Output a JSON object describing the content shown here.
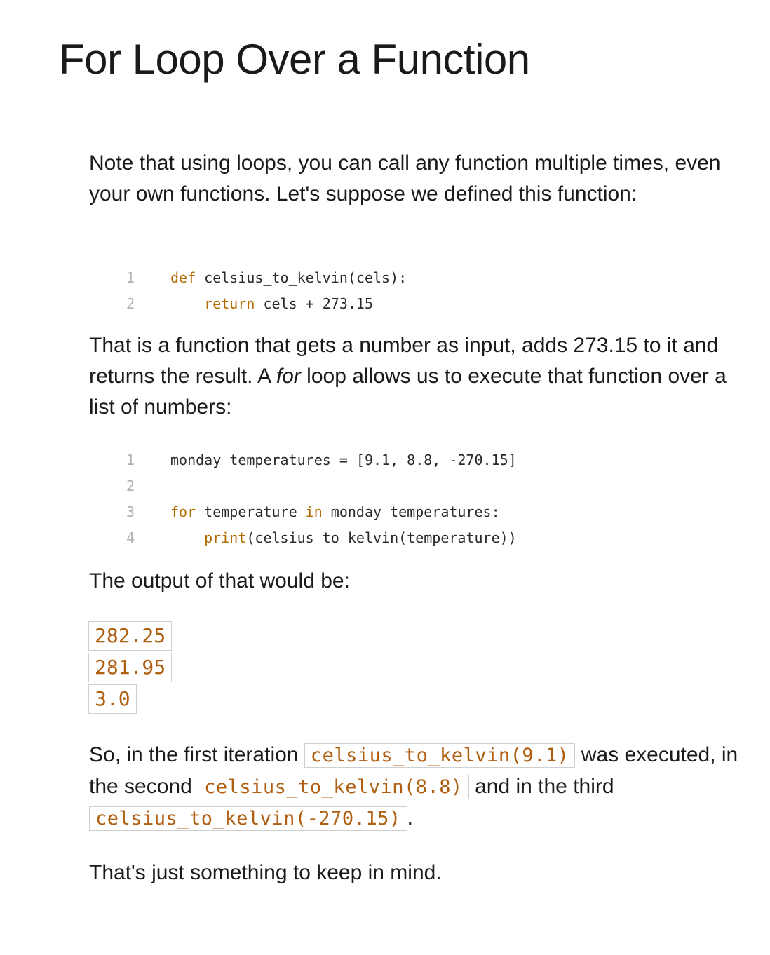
{
  "title": "For Loop Over a Function",
  "intro": "Note that using loops, you can call any function multiple times, even your own functions. Let's suppose we defined this function:",
  "code1": {
    "line_numbers": [
      "1",
      "2"
    ],
    "l1_kw": "def",
    "l1_rest": " celsius_to_kelvin(cels):",
    "l2_indent": "    ",
    "l2_kw": "return",
    "l2_rest": " cels + 273.15"
  },
  "explain": {
    "before": "That is a function that gets a number as input, adds 273.15 to it and returns the result. A ",
    "em": "for",
    "after": " loop allows us to execute that function over a list of numbers:"
  },
  "code2": {
    "line_numbers": [
      "1",
      "2",
      "3",
      "4"
    ],
    "l1": "monday_temperatures = [9.1, 8.8, -270.15]",
    "l3_kw1": "for",
    "l3_mid": " temperature ",
    "l3_kw2": "in",
    "l3_rest": " monday_temperatures:",
    "l4_indent": "    ",
    "l4_kw": "print",
    "l4_rest": "(celsius_to_kelvin(temperature))"
  },
  "output_intro": "The output of that would be:",
  "output": [
    "282.25",
    "281.95",
    "3.0"
  ],
  "iteration": {
    "t1": "So, in the first iteration ",
    "c1": "celsius_to_kelvin(9.1)",
    "t2": " was executed, in the second ",
    "c2": "celsius_to_kelvin(8.8)",
    "t3": " and in the third ",
    "c3": "celsius_to_kelvin(-270.15)",
    "t4": "."
  },
  "closing": "That's just something to keep in mind."
}
